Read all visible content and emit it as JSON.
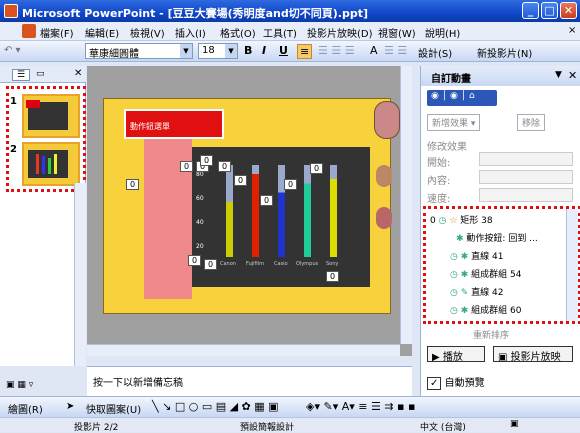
{
  "window": {
    "title": "Microsoft PowerPoint - [豆豆大賽場(秀明度and切不同頁).ppt]"
  },
  "menu": [
    "檔案(F)",
    "編輯(E)",
    "檢視(V)",
    "插入(I)",
    "格式(O)",
    "工具(T)",
    "投影片放映(D)",
    "視窗(W)",
    "說明(H)"
  ],
  "toolbar": {
    "font": "華康細圓體",
    "size": "18",
    "bold": "B",
    "italic": "I",
    "underline": "U",
    "design": "設計(S)",
    "new_slide": "新投影片(N)"
  },
  "slides": [
    {
      "num": "1"
    },
    {
      "num": "2"
    }
  ],
  "slide": {
    "button_text": "動作鈕選單",
    "bars_panel": {
      "yticks": [
        "80",
        "60",
        "40",
        "20"
      ],
      "labels": [
        "Canon",
        "Fujifilm",
        "Casio",
        "Olympus",
        "Sony"
      ]
    },
    "counters": [
      "0",
      "0",
      "0",
      "0",
      "0",
      "0",
      "0",
      "0",
      "0",
      "0",
      "0",
      "0",
      "0"
    ]
  },
  "notes_placeholder": "按一下以新增備忘稿",
  "task_pane": {
    "title": "自訂動畫",
    "add_effect": "新增效果 ▾",
    "remove": "移除",
    "modify_label": "修改效果",
    "start_label": "開始:",
    "property_label": "內容:",
    "speed_label": "速度:",
    "items": [
      {
        "order": "0",
        "name": "矩形 38"
      },
      {
        "order": "",
        "name": "動作按鈕: 回到 ..."
      },
      {
        "order": "",
        "name": "直線 41"
      },
      {
        "order": "",
        "name": "組成群組 54"
      },
      {
        "order": "",
        "name": "直線 42"
      },
      {
        "order": "",
        "name": "組成群組 60"
      }
    ],
    "reorder": "重新排序",
    "play": "播放",
    "slideshow": "投影片放映",
    "autopreview": "自動預覽"
  },
  "drawbar": {
    "draw": "繪圖(R)",
    "autoshapes": "快取圖案(U)"
  },
  "status": {
    "slide": "投影片 2/2",
    "design": "預設簡報設計",
    "lang": "中文 (台灣)"
  }
}
